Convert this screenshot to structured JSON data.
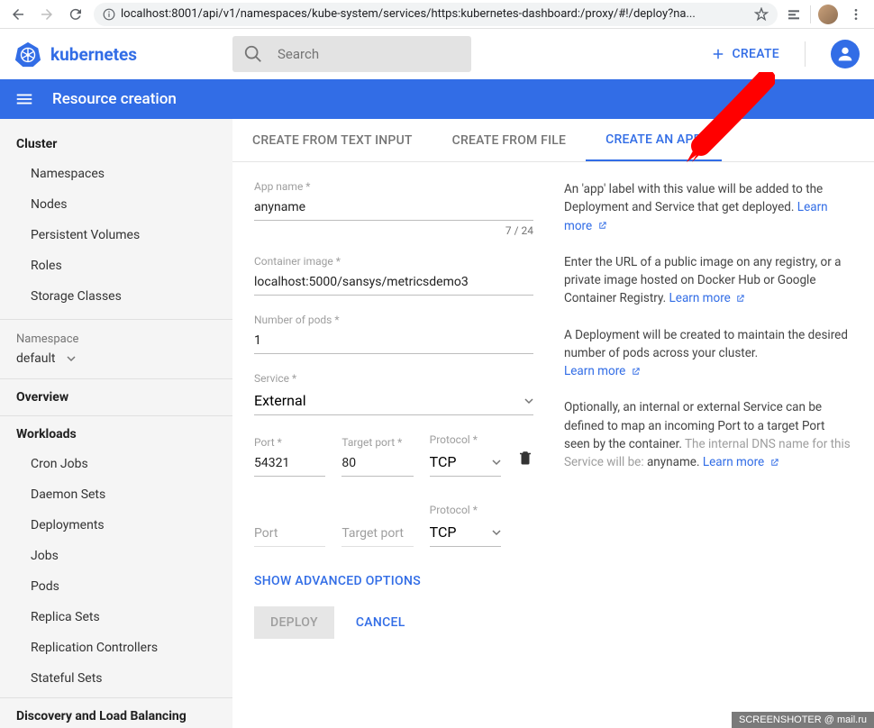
{
  "browser": {
    "url": "localhost:8001/api/v1/namespaces/kube-system/services/https:kubernetes-dashboard:/proxy/#!/deploy?na..."
  },
  "header": {
    "brand": "kubernetes",
    "search_placeholder": "Search",
    "create_label": "CREATE"
  },
  "bluebar": {
    "title": "Resource creation"
  },
  "sidebar": {
    "cluster_heading": "Cluster",
    "cluster_items": [
      "Namespaces",
      "Nodes",
      "Persistent Volumes",
      "Roles",
      "Storage Classes"
    ],
    "ns_label": "Namespace",
    "ns_value": "default",
    "overview": "Overview",
    "workloads_heading": "Workloads",
    "workloads_items": [
      "Cron Jobs",
      "Daemon Sets",
      "Deployments",
      "Jobs",
      "Pods",
      "Replica Sets",
      "Replication Controllers",
      "Stateful Sets"
    ],
    "discovery_heading": "Discovery and Load Balancing"
  },
  "tabs": {
    "text_input": "CREATE FROM TEXT INPUT",
    "from_file": "CREATE FROM FILE",
    "create_app": "CREATE AN APP"
  },
  "form": {
    "app_name_label": "App name *",
    "app_name_value": "anyname",
    "app_name_counter": "7 / 24",
    "image_label": "Container image *",
    "image_value": "localhost:5000/sansys/metricsdemo3",
    "pods_label": "Number of pods *",
    "pods_value": "1",
    "service_label": "Service *",
    "service_value": "External",
    "port_label": "Port *",
    "port_value": "54321",
    "target_label": "Target port *",
    "target_value": "80",
    "proto_label": "Protocol *",
    "proto_value": "TCP",
    "port2_placeholder": "Port",
    "target2_placeholder": "Target port",
    "proto2_label": "Protocol *",
    "proto2_value": "TCP",
    "advanced": "SHOW ADVANCED OPTIONS",
    "deploy": "DEPLOY",
    "cancel": "CANCEL"
  },
  "help": {
    "p1a": "An 'app' label with this value will be added to the Deployment and Service that get deployed. ",
    "learn": "Learn more",
    "p2a": "Enter the URL of a public image on any registry, or a private image hosted on Docker Hub or Google Container Registry. ",
    "p3a": "A Deployment will be created to maintain the desired number of pods across your cluster.",
    "p4a": "Optionally, an internal or external Service can be defined to map an incoming Port to a target Port seen by the container. ",
    "p4b": "The internal DNS name for this Service will be: ",
    "p4c": "anyname"
  },
  "watermark": "SCREENSHOTER @ mail.ru"
}
